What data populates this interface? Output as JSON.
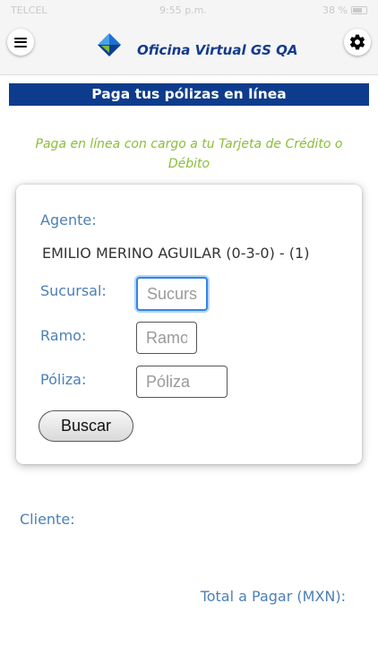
{
  "status_bar": {
    "carrier": "TELCEL",
    "time": "9:55 p.m.",
    "battery": "38 %"
  },
  "header": {
    "title": "Oficina Virtual GS QA",
    "menu_icon": "hamburger-menu-icon",
    "settings_icon": "gear-icon",
    "logo_colors": [
      "#1e6fd0",
      "#0d3d91",
      "#4aa0e8",
      "#7dbb35"
    ]
  },
  "banner": {
    "title": "Paga tus pólizas en línea",
    "color": "#0e3c8c"
  },
  "subtitle": "Paga en línea con cargo a tu Tarjeta de Crédito o Débito",
  "form": {
    "agent_label": "Agente:",
    "agent_value": "EMILIO MERINO AGUILAR (0-3-0) - (1)",
    "branch_label": "Sucursal:",
    "branch_placeholder": "Sucursal",
    "line_label": "Ramo:",
    "line_placeholder": "Ramo",
    "policy_label": "Póliza:",
    "policy_placeholder": "Póliza",
    "search_button": "Buscar"
  },
  "results": {
    "client_label": "Cliente:",
    "total_label": "Total a Pagar (MXN):"
  }
}
